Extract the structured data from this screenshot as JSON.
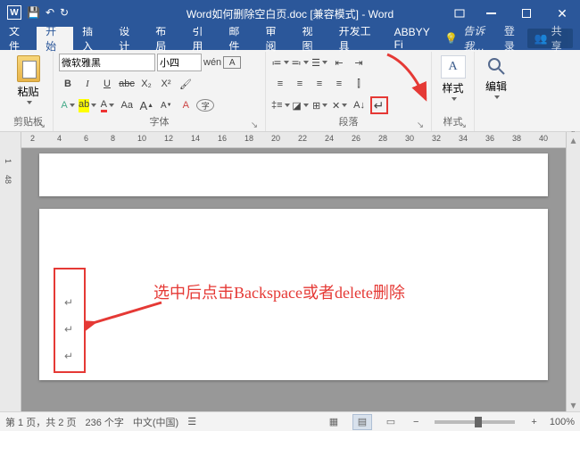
{
  "title": "Word如何删除空白页.doc [兼容模式] - Word",
  "qat": {
    "save": "保存",
    "undo": "撤销",
    "redo": "恢复"
  },
  "tabs": [
    "文件",
    "开始",
    "插入",
    "设计",
    "布局",
    "引用",
    "邮件",
    "审阅",
    "视图",
    "开发工具",
    "ABBYY Fi"
  ],
  "active_tab_index": 1,
  "tell_me": "告诉我…",
  "sign_in": "登录",
  "share": "共享",
  "ribbon": {
    "clipboard": {
      "label": "剪贴板",
      "paste": "粘贴"
    },
    "font": {
      "label": "字体",
      "name": "微软雅黑",
      "size": "小四",
      "bold": "B",
      "italic": "I",
      "underline": "U",
      "strike": "abc",
      "sub": "X₂",
      "sup": "X²",
      "phonetic": "wén",
      "charborder": "A",
      "ruby": "A",
      "highlight": "ab",
      "fontcolor": "A",
      "casing": "Aa",
      "grow": "A",
      "shrink": "A",
      "clear": "A",
      "enclose": "字"
    },
    "paragraph": {
      "label": "段落",
      "bullets": "•",
      "numbers": "1",
      "multilevel": "≡",
      "align_l": "≡",
      "align_c": "≡",
      "dec": "◁",
      "inc": "▷",
      "sort": "A↓",
      "show": "¶",
      "lsp": "≡",
      "shade": "▦",
      "border": "□",
      "char": "X",
      "ltr": "←",
      "rtl": "→"
    },
    "styles": {
      "label": "样式",
      "button": "样式"
    },
    "editing": {
      "label": "编辑",
      "button": "编辑"
    }
  },
  "ruler_marks": [
    2,
    4,
    6,
    8,
    10,
    12,
    14,
    16,
    18,
    20,
    22,
    24,
    26,
    28,
    30,
    32,
    34,
    36,
    38,
    40
  ],
  "vruler_marks": [
    "1",
    "48"
  ],
  "annotation": "选中后点击Backspace或者delete删除",
  "status": {
    "page": "第 1 页，共 2 页",
    "words": "236 个字",
    "lang": "中文(中国)",
    "zoom": "100%"
  }
}
